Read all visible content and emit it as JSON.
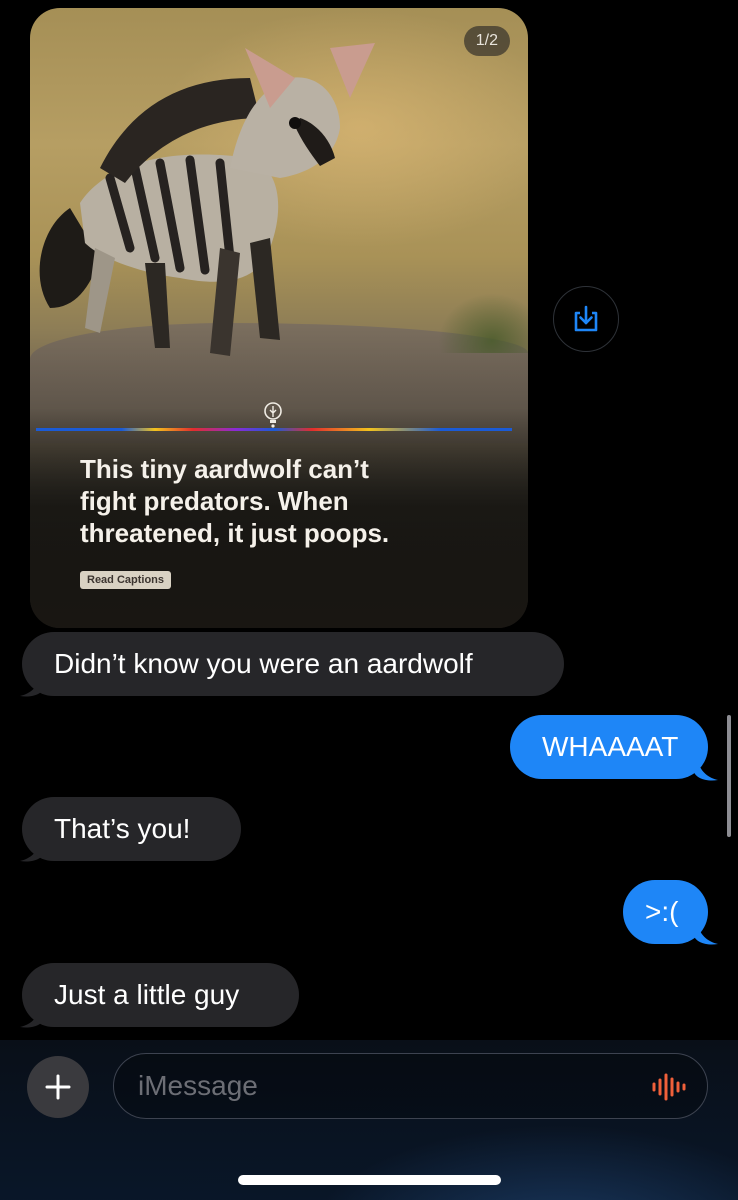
{
  "media_card": {
    "page_indicator": "1/2",
    "headline_line1": "This tiny aardwolf can’t",
    "headline_line2": "fight predators. When",
    "headline_line3": "threatened, it just poops.",
    "read_captions_label": "Read Captions"
  },
  "messages": [
    {
      "direction": "incoming",
      "text": "Didn’t know you were an aardwolf"
    },
    {
      "direction": "outgoing",
      "text": "WHAAAAT"
    },
    {
      "direction": "incoming",
      "text": "That’s you!"
    },
    {
      "direction": "outgoing",
      "text": ">:("
    },
    {
      "direction": "incoming",
      "text": "Just a little guy"
    }
  ],
  "composer": {
    "placeholder": "iMessage",
    "add_icon": "plus-icon",
    "audio_icon": "waveform-icon"
  },
  "save_icon": "save-to-photos-icon",
  "colors": {
    "incoming_bubble": "#262629",
    "outgoing_bubble": "#1e86f7",
    "accent": "#1e86f7",
    "waveform": "#f0603a"
  }
}
